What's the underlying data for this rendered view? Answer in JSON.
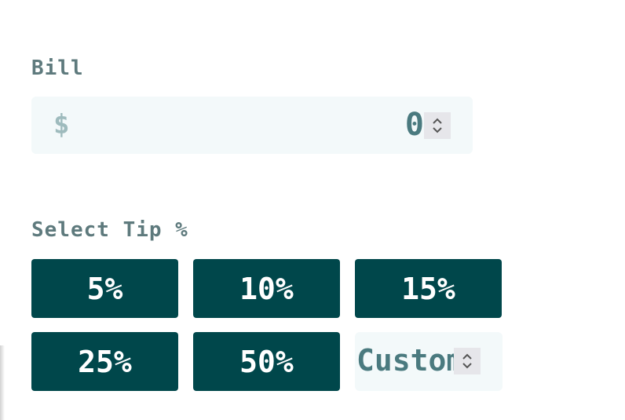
{
  "bill": {
    "label": "Bill",
    "currency_symbol": "$",
    "value": "0",
    "icon": "dollar-icon"
  },
  "tip": {
    "label": "Select Tip %",
    "options": [
      "5%",
      "10%",
      "15%",
      "25%",
      "50%"
    ],
    "custom_text": "Custom",
    "custom_placeholder": "Custom"
  },
  "colors": {
    "button_bg": "#00474b",
    "button_text": "#ffffff",
    "field_bg": "#f3f9fa",
    "label": "#5e7a7d",
    "value_text": "#4a7a7f"
  }
}
